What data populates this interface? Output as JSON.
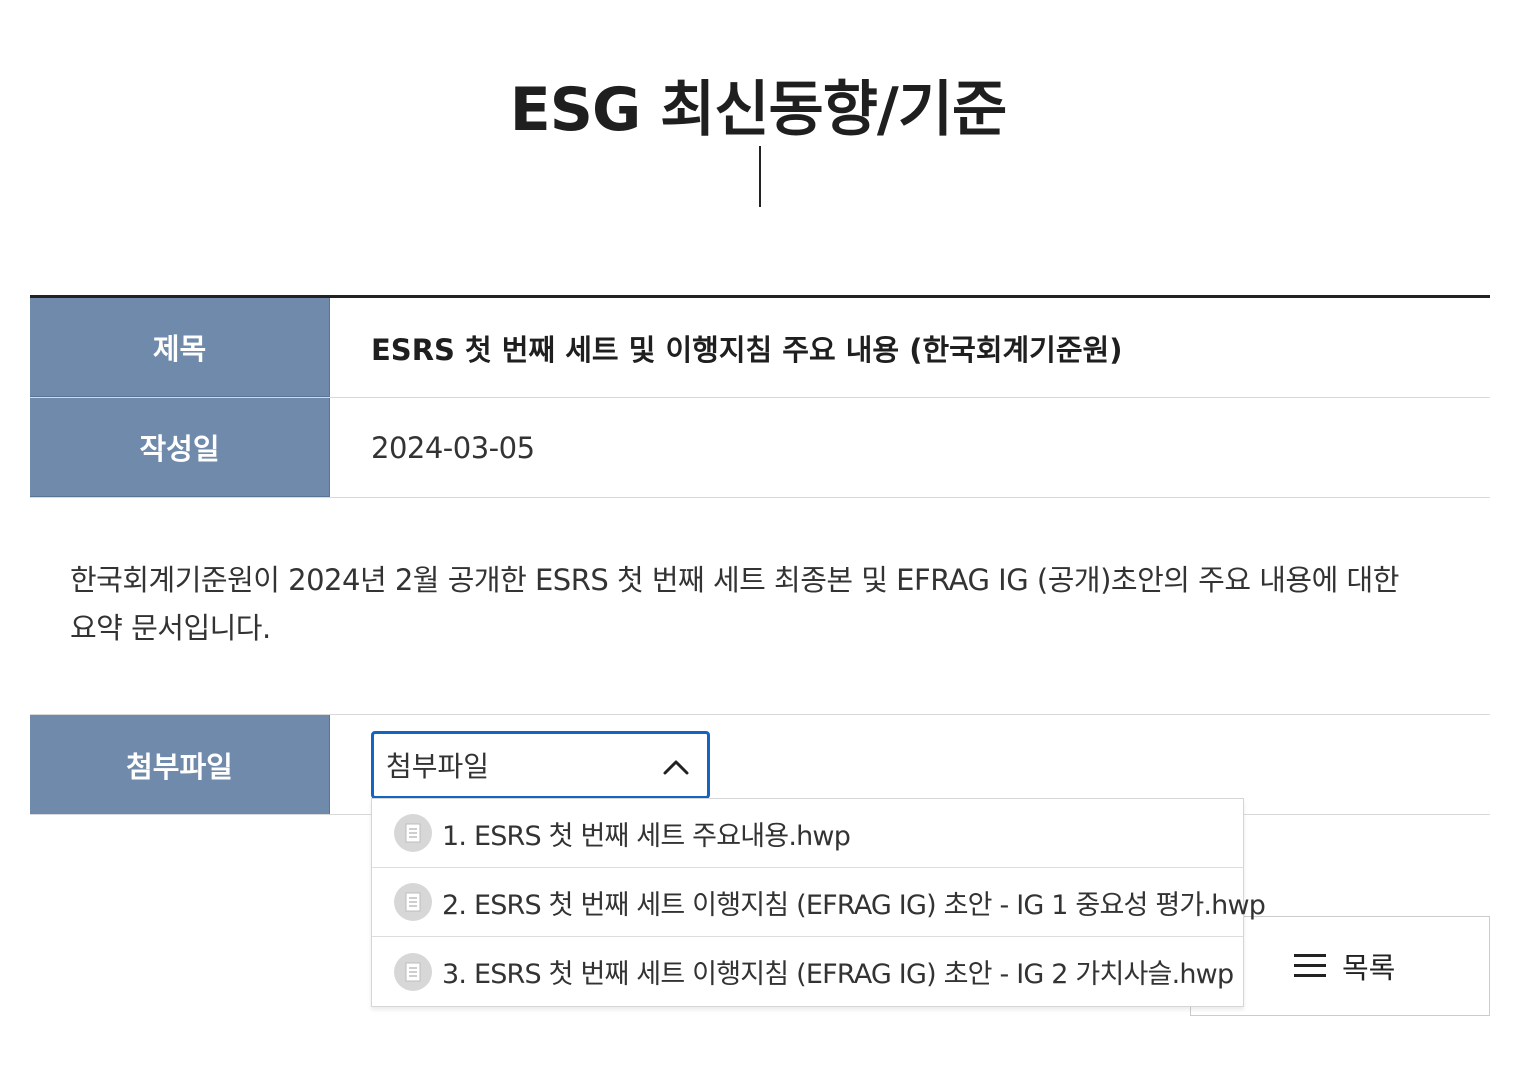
{
  "page": {
    "title": "ESG 최신동향/기준"
  },
  "post": {
    "title_label": "제목",
    "title_value": "ESRS 첫 번째 세트 및 이행지침 주요 내용 (한국회계기준원)",
    "date_label": "작성일",
    "date_value": "2024-03-05",
    "body_line1": "한국회계기준원이 2024년 2월 공개한 ESRS 첫 번째 세트 최종본 및 EFRAG IG (공개)초안의 주요 내용에 대한",
    "body_line2": "요약 문서입니다."
  },
  "attachments": {
    "label": "첨부파일",
    "select_value": "첨부파일",
    "options": [
      {
        "label": "1. ESRS 첫 번째 세트 주요내용.hwp",
        "icon": "document-icon"
      },
      {
        "label": "2. ESRS 첫 번째 세트 이행지침 (EFRAG IG) 초안 - IG 1 중요성 평가.hwp",
        "icon": "document-icon"
      },
      {
        "label": "3. ESRS 첫 번째 세트 이행지침 (EFRAG IG) 초안 - IG 2 가치사슬.hwp",
        "icon": "document-icon"
      }
    ]
  },
  "actions": {
    "list_label": "목록",
    "list_icon": "hamburger-menu-icon"
  },
  "colors": {
    "label_bg": "#6f8aab",
    "focus_border": "#1565c0"
  }
}
